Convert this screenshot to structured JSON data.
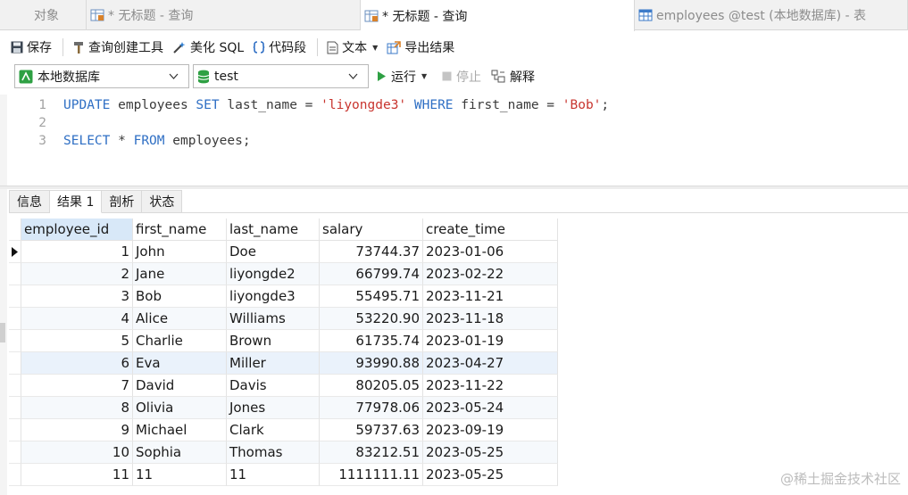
{
  "tabs": [
    {
      "label": "对象",
      "active": false,
      "icon": null
    },
    {
      "label": "* 无标题 - 查询",
      "active": false,
      "icon": "query-grid-icon"
    },
    {
      "label": "* 无标题 - 查询",
      "active": true,
      "icon": "query-grid-icon"
    },
    {
      "label": "employees @test (本地数据库) - 表",
      "active": false,
      "icon": "table-grid-icon"
    }
  ],
  "toolbar": {
    "save": "保存",
    "query_builder": "查询创建工具",
    "beautify_sql": "美化 SQL",
    "code_snippet": "代码段",
    "text": "文本",
    "export": "导出结果"
  },
  "connection": {
    "server": "本地数据库",
    "database": "test",
    "run": "运行",
    "stop": "停止",
    "explain": "解释"
  },
  "editor": {
    "lines": [
      {
        "number": "1",
        "tokens": [
          {
            "t": "UPDATE",
            "c": "kw"
          },
          {
            "t": " employees ",
            "c": "plain"
          },
          {
            "t": "SET",
            "c": "kw"
          },
          {
            "t": " last_name = ",
            "c": "plain"
          },
          {
            "t": "'liyongde3'",
            "c": "str"
          },
          {
            "t": " ",
            "c": "plain"
          },
          {
            "t": "WHERE",
            "c": "kw"
          },
          {
            "t": " first_name = ",
            "c": "plain"
          },
          {
            "t": "'Bob'",
            "c": "str"
          },
          {
            "t": ";",
            "c": "plain"
          }
        ]
      },
      {
        "number": "2",
        "tokens": []
      },
      {
        "number": "3",
        "tokens": [
          {
            "t": "SELECT",
            "c": "kw"
          },
          {
            "t": " * ",
            "c": "plain"
          },
          {
            "t": "FROM",
            "c": "kw"
          },
          {
            "t": " employees;",
            "c": "plain"
          }
        ]
      }
    ]
  },
  "result_tabs": [
    {
      "label": "信息",
      "active": false
    },
    {
      "label": "结果 1",
      "active": true
    },
    {
      "label": "剖析",
      "active": false
    },
    {
      "label": "状态",
      "active": false
    }
  ],
  "table": {
    "columns": [
      "employee_id",
      "first_name",
      "last_name",
      "salary",
      "create_time"
    ],
    "rows": [
      [
        "1",
        "John",
        "Doe",
        "73744.37",
        "2023-01-06"
      ],
      [
        "2",
        "Jane",
        "liyongde2",
        "66799.74",
        "2023-02-22"
      ],
      [
        "3",
        "Bob",
        "liyongde3",
        "55495.71",
        "2023-11-21"
      ],
      [
        "4",
        "Alice",
        "Williams",
        "53220.90",
        "2023-11-18"
      ],
      [
        "5",
        "Charlie",
        "Brown",
        "61735.74",
        "2023-01-19"
      ],
      [
        "6",
        "Eva",
        "Miller",
        "93990.88",
        "2023-04-27"
      ],
      [
        "7",
        "David",
        "Davis",
        "80205.05",
        "2023-11-22"
      ],
      [
        "8",
        "Olivia",
        "Jones",
        "77978.06",
        "2023-05-24"
      ],
      [
        "9",
        "Michael",
        "Clark",
        "59737.63",
        "2023-09-19"
      ],
      [
        "10",
        "Sophia",
        "Thomas",
        "83212.51",
        "2023-05-25"
      ],
      [
        "11",
        "11",
        "11",
        "1111111.11",
        "2023-05-25"
      ]
    ],
    "current_row": 0,
    "highlighted_row": 5
  },
  "watermark": "@稀土掘金技术社区",
  "colors": {
    "keyword": "#2f6fc4",
    "string": "#c8352f",
    "run_green": "#2ea043",
    "header_selected": "#d8e8f8"
  }
}
